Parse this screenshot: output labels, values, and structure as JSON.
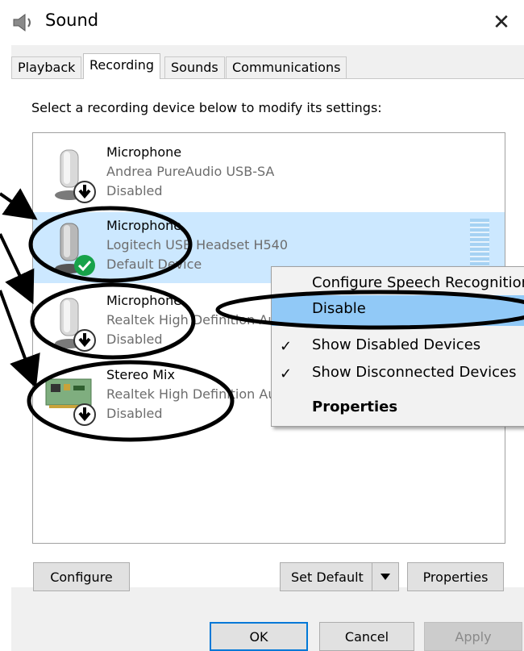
{
  "window": {
    "title": "Sound",
    "icon": "speaker-icon",
    "close_glyph": "✕"
  },
  "tabs": [
    {
      "label": "Playback",
      "active": false
    },
    {
      "label": "Recording",
      "active": true
    },
    {
      "label": "Sounds",
      "active": false
    },
    {
      "label": "Communications",
      "active": false
    }
  ],
  "instruction": "Select a recording device below to modify its settings:",
  "devices": [
    {
      "name": "Microphone",
      "description": "Andrea PureAudio USB-SA",
      "status": "Disabled",
      "icon": "microphone-icon",
      "badge": "down-arrow-badge",
      "selected": false
    },
    {
      "name": "Microphone",
      "description": "Logitech USB Headset H540",
      "status": "Default Device",
      "icon": "microphone-icon",
      "badge": "green-check-badge",
      "selected": true
    },
    {
      "name": "Microphone",
      "description": "Realtek High Definition Audio",
      "status": "Disabled",
      "icon": "microphone-icon",
      "badge": "down-arrow-badge",
      "selected": false
    },
    {
      "name": "Stereo Mix",
      "description": "Realtek High Definition Audio",
      "status": "Disabled",
      "icon": "sound-card-icon",
      "badge": "down-arrow-badge",
      "selected": false
    }
  ],
  "context_menu": {
    "items": [
      {
        "label": "Configure Speech Recognition",
        "checked": false,
        "highlighted": false,
        "bold": false
      },
      {
        "label": "Disable",
        "checked": false,
        "highlighted": true,
        "bold": false
      },
      {
        "label": "Show Disabled Devices",
        "checked": true,
        "highlighted": false,
        "bold": false
      },
      {
        "label": "Show Disconnected Devices",
        "checked": true,
        "highlighted": false,
        "bold": false
      },
      {
        "label": "Properties",
        "checked": false,
        "highlighted": false,
        "bold": true
      }
    ],
    "check_glyph": "✓"
  },
  "buttons": {
    "configure": "Configure",
    "set_default": "Set Default",
    "properties": "Properties",
    "ok": "OK",
    "cancel": "Cancel",
    "apply": "Apply"
  },
  "colors": {
    "selection": "#cce8ff",
    "menu_highlight": "#91c9f7",
    "accent": "#0078d7",
    "default_check": "#17a24a",
    "annotation": "#000000"
  }
}
